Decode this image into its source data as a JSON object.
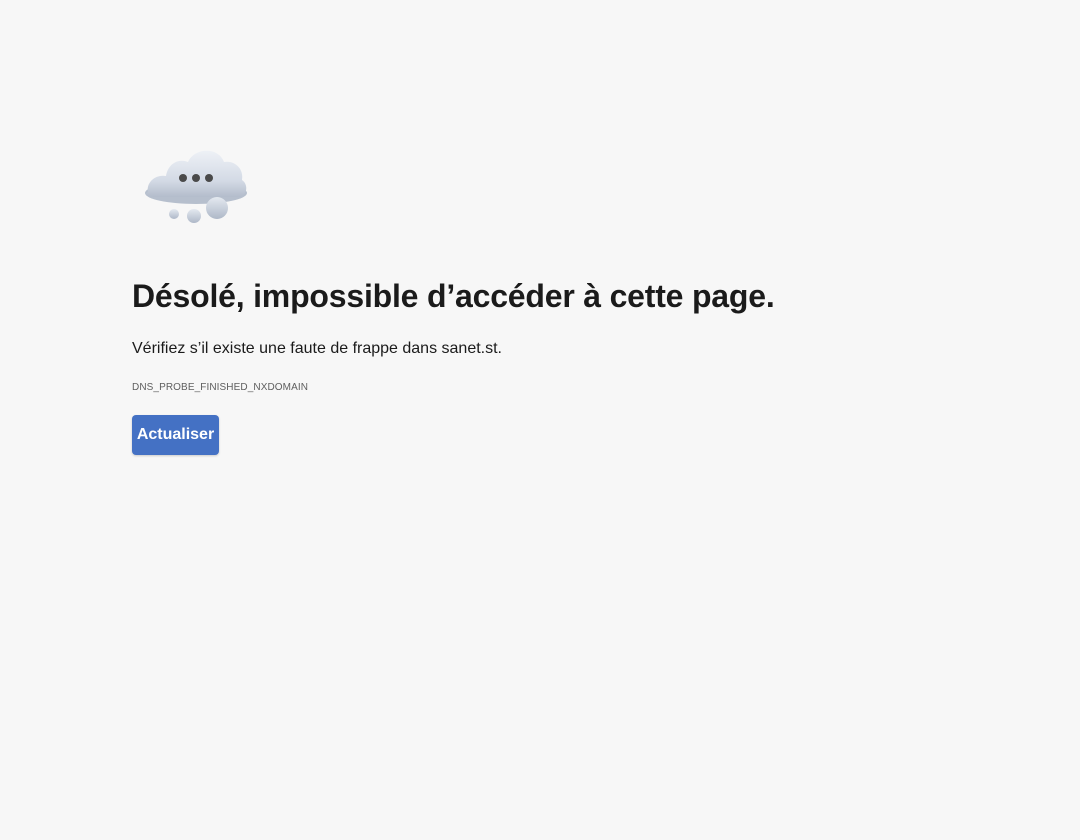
{
  "error_page": {
    "title": "Désolé, impossible d’accéder à cette page.",
    "message": "Vérifiez s’il existe une faute de frappe dans sanet.st.",
    "error_code": "DNS_PROBE_FINISHED_NXDOMAIN",
    "refresh_button_label": "Actualiser",
    "illustration_icon": "thinking-cloud-icon"
  },
  "colors": {
    "background": "#f7f7f7",
    "text": "#1b1b1b",
    "error_code_text": "#5e5e5e",
    "button_background": "#4471c4",
    "button_text": "#ffffff"
  }
}
